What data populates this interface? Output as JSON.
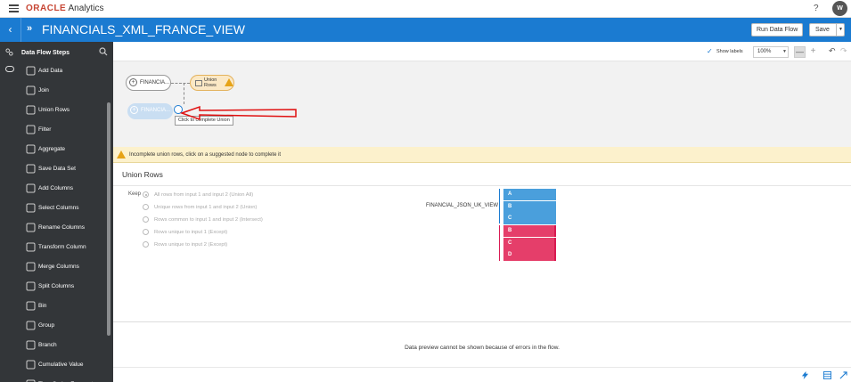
{
  "app": {
    "brand": "ORACLE",
    "product": "Analytics",
    "help": "?",
    "user_initial": "W"
  },
  "titlebar": {
    "back": "‹",
    "icon": "»",
    "title": "FINANCIALS_XML_FRANCE_VIEW",
    "run_label": "Run Data Flow",
    "save_label": "Save",
    "save_caret": "▼"
  },
  "sidebar": {
    "title": "Data Flow Steps",
    "steps": [
      {
        "label": "Add Data",
        "icon": "add-data-icon"
      },
      {
        "label": "Join",
        "icon": "join-icon"
      },
      {
        "label": "Union Rows",
        "icon": "union-rows-icon"
      },
      {
        "label": "Filter",
        "icon": "filter-icon"
      },
      {
        "label": "Aggregate",
        "icon": "aggregate-icon"
      },
      {
        "label": "Save Data Set",
        "icon": "save-data-set-icon"
      },
      {
        "label": "Add Columns",
        "icon": "add-columns-icon"
      },
      {
        "label": "Select Columns",
        "icon": "select-columns-icon"
      },
      {
        "label": "Rename Columns",
        "icon": "rename-columns-icon"
      },
      {
        "label": "Transform Column",
        "icon": "transform-column-icon"
      },
      {
        "label": "Merge Columns",
        "icon": "merge-columns-icon"
      },
      {
        "label": "Split Columns",
        "icon": "split-columns-icon"
      },
      {
        "label": "Bin",
        "icon": "bin-icon"
      },
      {
        "label": "Group",
        "icon": "group-icon"
      },
      {
        "label": "Branch",
        "icon": "branch-icon"
      },
      {
        "label": "Cumulative Value",
        "icon": "cumulative-value-icon"
      },
      {
        "label": "Time Series Forecast",
        "icon": "time-series-icon"
      }
    ]
  },
  "canvas": {
    "show_labels": "Show labels",
    "zoom": "100%",
    "zoom_minus": "—",
    "zoom_plus": "+",
    "node1": "FINANCIA...",
    "node2_line1": "Union",
    "node2_line2": "Rows",
    "node3": "FINANCIA...",
    "tooltip": "Click to complete Union"
  },
  "warning": {
    "text": "Incomplete union rows, click on a suggested node to complete it"
  },
  "union": {
    "title": "Union Rows",
    "keep_label": "Keep",
    "options": [
      "All rows from input 1 and input 2 (Union All)",
      "Unique rows from input 1 and input 2 (Union)",
      "Rows common to input 1 and input 2 (Intersect)",
      "Rows unique to input 1 (Except)",
      "Rows unique to input 2 (Except)"
    ],
    "selected_index": 0,
    "dataset_label": "FINANCIAL_JSON_UK_VIEW",
    "columns_input1": [
      "A",
      "B",
      "C"
    ],
    "columns_input2": [
      "B",
      "C",
      "D"
    ],
    "colors": {
      "input1": "#4a9fdc",
      "input2": "#e53e6a"
    }
  },
  "preview": {
    "message": "Data preview cannot be shown because of errors in the flow."
  },
  "accent": "#1b7bd1"
}
